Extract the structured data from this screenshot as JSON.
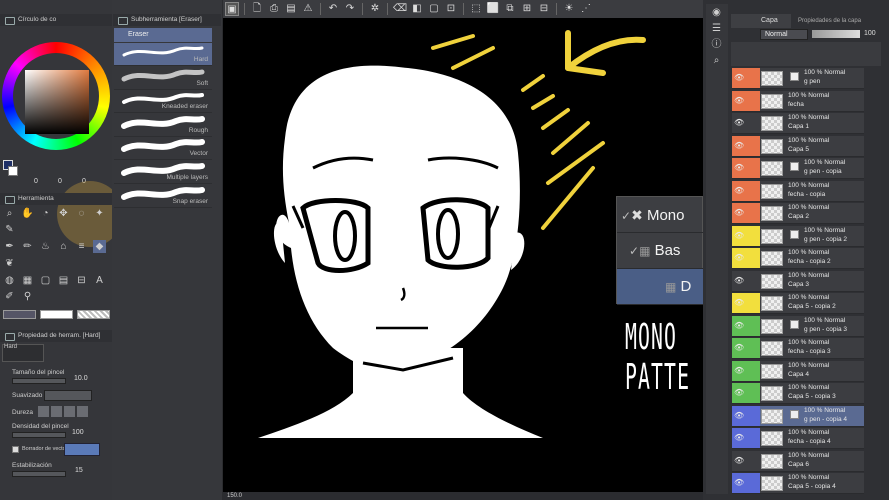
{
  "colors": {
    "accent": "#5a6a92",
    "canvas_bg": "#000000",
    "arrow": "#f0d23c",
    "layer_orange": "#e8734a",
    "layer_yellow": "#f2df3d",
    "layer_green": "#5fbf55",
    "layer_blue": "#5a6ad8"
  },
  "color_panel": {
    "title": "Círculo de co"
  },
  "subtool_panel": {
    "title": "Subherramienta [Eraser]",
    "group": "Eraser",
    "brushes": [
      {
        "label": "Hard",
        "selected": true
      },
      {
        "label": "Soft"
      },
      {
        "label": "Kneaded eraser"
      },
      {
        "label": "Rough"
      },
      {
        "label": "Vector"
      },
      {
        "label": "Multiple layers"
      },
      {
        "label": "Snap eraser"
      }
    ]
  },
  "tool_panel": {
    "title": "Herramienta"
  },
  "property_panel": {
    "title": "Propiedad de herram. [Hard]",
    "preset": "Hard",
    "brush_size_label": "Tamaño del pincel",
    "brush_size_value": "10.0",
    "smoothing_label": "Suavizado",
    "hardness_label": "Dureza",
    "density_label": "Densidad del pincel",
    "density_value": "100",
    "stabilization_label": "Estabilización",
    "stabilization_value": "15",
    "erase_vector_label": "Borrador de vecto"
  },
  "color_values": [
    "0",
    "0",
    "0"
  ],
  "status_bar": {
    "zoom": "150.0"
  },
  "popup_menu": {
    "items": [
      {
        "label": "Mono",
        "icon": "x-icon"
      },
      {
        "label": "Bas",
        "icon": "checker-icon"
      },
      {
        "label": "D",
        "icon": "checker-icon"
      }
    ]
  },
  "overlay_text": {
    "line1": "MONO",
    "line2": "PATTE"
  },
  "layers_panel": {
    "tab_layer": "Capa",
    "tab_props": "Propiedades de la capa",
    "blend_mode": "Normal",
    "opacity": "100",
    "layers": [
      {
        "l1": "100 % Normal",
        "l2": "g pen",
        "color": "orange",
        "mask": true
      },
      {
        "l1": "100 % Normal",
        "l2": "fecha",
        "color": "orange"
      },
      {
        "l1": "100 % Normal",
        "l2": "Capa 1",
        "color": "none"
      },
      {
        "l1": "100 % Normal",
        "l2": "Capa 5",
        "color": "orange"
      },
      {
        "l1": "100 % Normal",
        "l2": "g pen - copia",
        "color": "orange",
        "mask": true
      },
      {
        "l1": "100 % Normal",
        "l2": "fecha - copia",
        "color": "orange"
      },
      {
        "l1": "100 % Normal",
        "l2": "Capa 2",
        "color": "orange"
      },
      {
        "l1": "100 % Normal",
        "l2": "g pen - copia 2",
        "color": "yellow",
        "mask": true
      },
      {
        "l1": "100 % Normal",
        "l2": "fecha - copia 2",
        "color": "yellow"
      },
      {
        "l1": "100 % Normal",
        "l2": "Capa 3",
        "color": "none"
      },
      {
        "l1": "100 % Normal",
        "l2": "Capa 5 - copia 2",
        "color": "yellow"
      },
      {
        "l1": "100 % Normal",
        "l2": "g pen - copia 3",
        "color": "green",
        "mask": true
      },
      {
        "l1": "100 % Normal",
        "l2": "fecha - copia 3",
        "color": "green"
      },
      {
        "l1": "100 % Normal",
        "l2": "Capa 4",
        "color": "green"
      },
      {
        "l1": "100 % Normal",
        "l2": "Capa 5 - copia 3",
        "color": "green"
      },
      {
        "l1": "100 % Normal",
        "l2": "g pen - copia 4",
        "color": "blue",
        "mask": true,
        "selected": true
      },
      {
        "l1": "100 % Normal",
        "l2": "fecha - copia 4",
        "color": "blue"
      },
      {
        "l1": "100 % Normal",
        "l2": "Capa 6",
        "color": "none"
      },
      {
        "l1": "100 % Normal",
        "l2": "Capa 5 - copia 4",
        "color": "blue"
      }
    ]
  }
}
